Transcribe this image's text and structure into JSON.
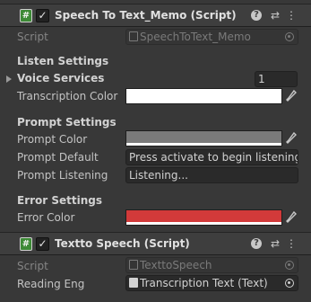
{
  "component1": {
    "title": "Speech To Text_Memo (Script)",
    "enabled": true,
    "script_label": "Script",
    "script_value": "SpeechToText_Memo",
    "listen_section": "Listen Settings",
    "voice_services_label": "Voice Services",
    "voice_services_count": "1",
    "transcription_color_label": "Transcription Color",
    "transcription_color": "#ffffff",
    "prompt_section": "Prompt Settings",
    "prompt_color_label": "Prompt Color",
    "prompt_color": "#7a7a7a",
    "prompt_default_label": "Prompt Default",
    "prompt_default_value": "Press activate to begin listening",
    "prompt_listening_label": "Prompt Listening",
    "prompt_listening_value": "Listening...",
    "error_section": "Error Settings",
    "error_color_label": "Error Color",
    "error_color": "#d23a3a"
  },
  "component2": {
    "title": "Textto Speech (Script)",
    "enabled": true,
    "script_label": "Script",
    "script_value": "TexttoSpeech",
    "reading_eng_label": "Reading Eng",
    "reading_eng_value": "Transcription Text (Text)"
  },
  "icons": {
    "script_badge": "#",
    "checkmark": "✓",
    "help": "?",
    "preset": "⇄",
    "menu": "⋮"
  }
}
